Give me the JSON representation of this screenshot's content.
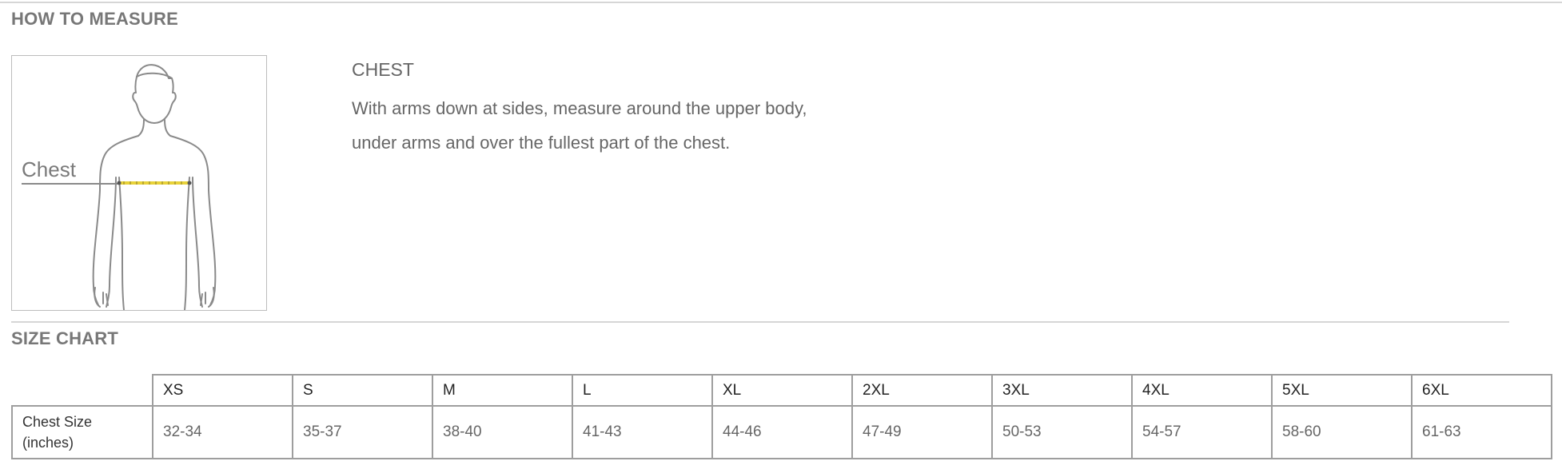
{
  "how_to_measure": {
    "heading": "HOW TO MEASURE",
    "figure_label": "Chest",
    "measure_title": "CHEST",
    "measure_lines": [
      "With arms down at sides, measure around the upper body,",
      "under arms and over the fullest part of the chest."
    ]
  },
  "size_chart": {
    "heading": "SIZE CHART",
    "sizes": [
      "XS",
      "S",
      "M",
      "L",
      "XL",
      "2XL",
      "3XL",
      "4XL",
      "5XL",
      "6XL"
    ],
    "row_label_lines": [
      "Chest Size",
      "(inches)"
    ],
    "chest_values": [
      "32-34",
      "35-37",
      "38-40",
      "41-43",
      "44-46",
      "47-49",
      "50-53",
      "54-57",
      "58-60",
      "61-63"
    ]
  },
  "colors": {
    "heading": "#777777",
    "rule": "#d6d6d6",
    "table_border": "#9e9e9e",
    "tape_measure": "#e8d23a",
    "figure_outline": "#8a8a8a"
  }
}
